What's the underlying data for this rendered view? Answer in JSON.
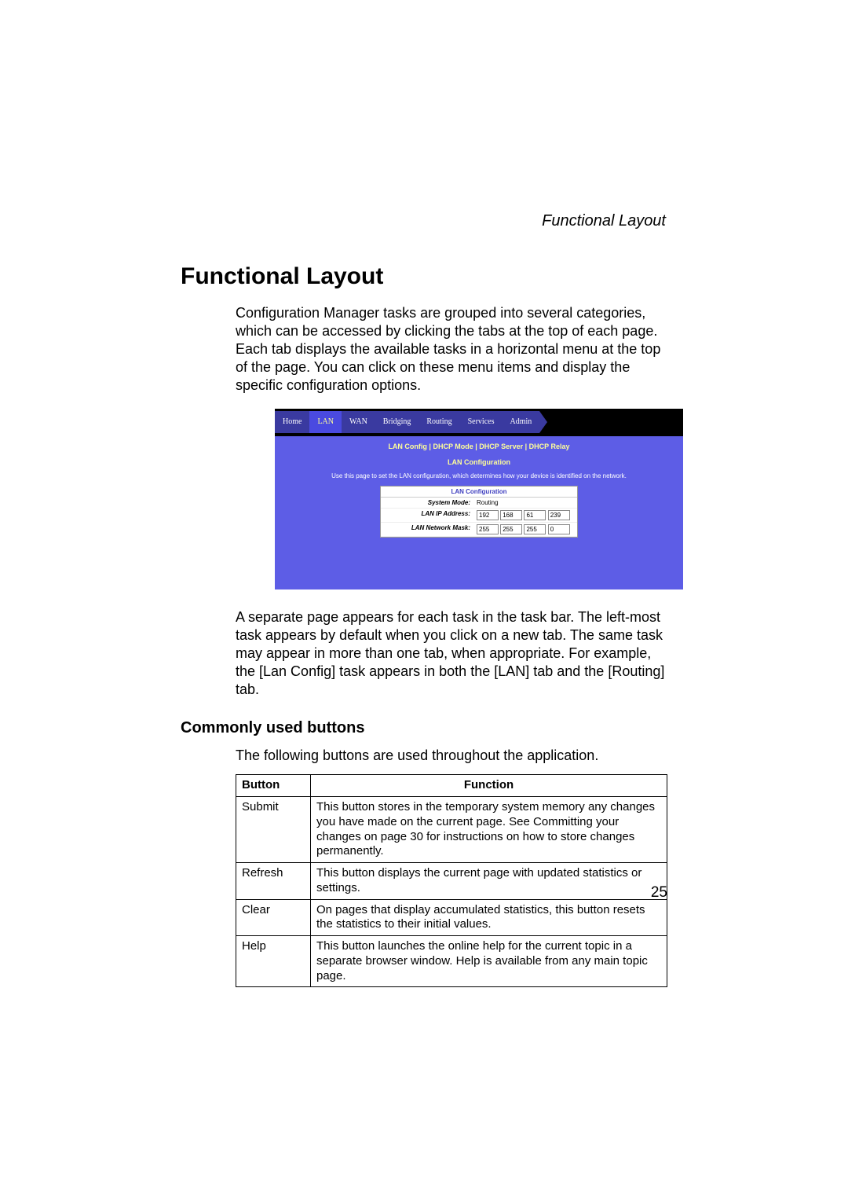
{
  "running_head": "Functional Layout",
  "title": "Functional Layout",
  "paragraph1": "Configuration Manager tasks are grouped into several categories, which can be accessed by clicking the tabs at the top of each page. Each tab displays the available tasks in a horizontal menu at the top of the page. You can click on these menu items and display the specific configuration options.",
  "paragraph2": "A separate page appears for each task in the task bar. The left-most task appears by default when you click on a new tab. The same task may appear in more than one tab, when appropriate. For example, the [Lan Config] task appears in both the [LAN] tab and the [Routing] tab.",
  "subsection": "Commonly used buttons",
  "intro_line": "The following buttons are used throughout the application.",
  "table": {
    "headers": {
      "col1": "Button",
      "col2": "Function"
    },
    "rows": [
      {
        "button": "Submit",
        "function": "This button stores in the temporary system memory any changes you have made on the current page. See Committing your changes on page 30 for instructions on how to store changes permanently."
      },
      {
        "button": "Refresh",
        "function": "This button displays the current page with updated statistics or settings."
      },
      {
        "button": "Clear",
        "function": "On pages that display accumulated statistics, this button resets the statistics to their initial values."
      },
      {
        "button": "Help",
        "function": "This button launches the online help for the current topic in a separate browser window. Help is available from any main topic page."
      }
    ]
  },
  "screenshot": {
    "tabs": [
      "Home",
      "LAN",
      "WAN",
      "Bridging",
      "Routing",
      "Services",
      "Admin"
    ],
    "submenu": "LAN Config  |  DHCP Mode  |  DHCP Server  |  DHCP Relay",
    "heading": "LAN Configuration",
    "desc": "Use this page to set the LAN configuration, which determines how your device is identified on the network.",
    "form_title": "LAN Configuration",
    "rows": [
      {
        "label": "System Mode:",
        "value": "Routing"
      },
      {
        "label": "LAN IP Address:",
        "ips": [
          "192",
          "168",
          "61",
          "239"
        ]
      },
      {
        "label": "LAN Network Mask:",
        "ips": [
          "255",
          "255",
          "255",
          "0"
        ]
      }
    ]
  },
  "page_number": "25"
}
